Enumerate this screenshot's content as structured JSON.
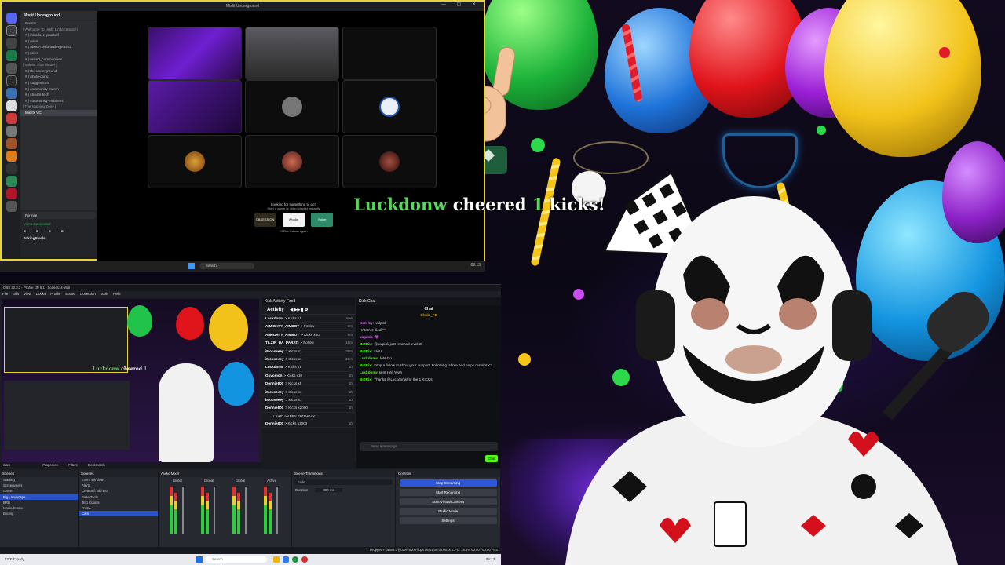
{
  "discord": {
    "window_title": "Misfit Underground",
    "server_name": "Misfit Underground",
    "channels": [
      {
        "label": "Events",
        "type": "item"
      },
      {
        "label": "| Welcome To Misfit Underground |",
        "type": "cat"
      },
      {
        "label": "# | introduce-yourself",
        "type": "item"
      },
      {
        "label": "# | rules",
        "type": "item"
      },
      {
        "label": "# | about-misfit-underground",
        "type": "item"
      },
      {
        "label": "# | roles",
        "type": "item"
      },
      {
        "label": "# | united_communities",
        "type": "item"
      },
      {
        "label": "| Videos That Matter |",
        "type": "cat"
      },
      {
        "label": "# | the-underground",
        "type": "item"
      },
      {
        "label": "# | photo-dump",
        "type": "item"
      },
      {
        "label": "# | suggestions",
        "type": "item"
      },
      {
        "label": "# | community-merch",
        "type": "item"
      },
      {
        "label": "# | stream-tech",
        "type": "item"
      },
      {
        "label": "# | community-emblems",
        "type": "item"
      },
      {
        "label": "| The Vapping Zone |",
        "type": "cat"
      },
      {
        "label": "Misfits VC",
        "type": "sel"
      }
    ],
    "activity_game": "Fortnite",
    "voice_status": "Video Connected",
    "username": "JokingPixels",
    "activity_prompt": "Looking for something to do?",
    "activity_sub": "Start a game or video playlist instantly",
    "activity_games": [
      "OBSESSION",
      "Wordle",
      "Poker"
    ],
    "dont_show": "Don't show again"
  },
  "taskbar_top": {
    "search_placeholder": "Search",
    "time": "09:13"
  },
  "alert": {
    "username": "Luckdonw",
    "verb": "cheered",
    "amount": "1",
    "unit": "kicks!"
  },
  "obs": {
    "title": "OBS 32.0.2 - Profile: JP 6.1 - Scenes: 4-Wall",
    "menu": [
      "File",
      "Edit",
      "View",
      "Docks",
      "Profile",
      "Scene Collection",
      "Tools",
      "Help"
    ],
    "scene_bar": "Cam",
    "scene_bar_tabs": [
      "Properties",
      "Filters",
      "Deskmerch"
    ],
    "scenes_header": "Scenes",
    "scenes": [
      "Starting",
      "Screenviews",
      "Game",
      "Big Landscape",
      "BRB",
      "Movie Scene",
      "Ending"
    ],
    "sources_header": "Sources",
    "sources": [
      "Event Window",
      "Alerts",
      "Creator.fl fold BG",
      "Base Tools",
      "Text Counts",
      "Game",
      "Cam"
    ],
    "mixer_header": "Audio Mixer",
    "mixer_channels": [
      "Global",
      "Global",
      "Global",
      "Active"
    ],
    "transitions_header": "Scene Transitions",
    "transition_value": "Fade",
    "duration_label": "Duration",
    "duration_value": "300 ms",
    "controls_header": "Controls",
    "controls": [
      "Stop Streaming",
      "Start Recording",
      "Start Virtual Camera",
      "Studio Mode",
      "Settings"
    ],
    "status": "Dropped Frames 0 (0.0%)   8000 kbps   04:41:06   00:00:00   CPU: 18.3%   60.00 / 60.00 FPS"
  },
  "feed": {
    "dock_title": "Kick Activity Feed",
    "toolbar_label": "Activity",
    "rows": [
      {
        "user": "Luckdonw",
        "action": "> Kicks x1",
        "time": "now"
      },
      {
        "user": "AIMIGHTY_AIMBOT",
        "action": "> Follow",
        "time": "8m"
      },
      {
        "user": "AIMIGHTY_AIMBOT",
        "action": "> Kicks x50",
        "time": "8m"
      },
      {
        "user": "TILZIN_DA_PARATI",
        "action": "> Follow",
        "time": "15m"
      },
      {
        "user": "iMouseeey",
        "action": "> Kicks x1",
        "time": "26m"
      },
      {
        "user": "iMouseeey",
        "action": "> Kicks x1",
        "time": "26m"
      },
      {
        "user": "Luckdonw",
        "action": "> Kicks x1",
        "time": "1h"
      },
      {
        "user": "Guyomon",
        "action": "> Kicks x10",
        "time": "1h"
      },
      {
        "user": "Donnie800",
        "action": "> Kicks x5",
        "time": "1h"
      },
      {
        "user": "iMouseeey",
        "action": "> Kicks x1",
        "time": "1h"
      },
      {
        "user": "iMouseeey",
        "action": "> Kicks x1",
        "time": "1h"
      },
      {
        "user": "Donnie800",
        "action": "> Kicks x2000",
        "time": "1h"
      }
    ],
    "sub_message": "I SAID HAPPY BIRTHDAY",
    "last_row": {
      "user": "Donnie800",
      "action": "> Kicks x1000",
      "time": "1h"
    }
  },
  "kick_chat": {
    "dock_title": "Kick Chat",
    "chat_title": "Chat",
    "pinned_user": "Chuila_PE",
    "messages": [
      {
        "user": "Sent by:",
        "text": "valpink",
        "color": "#d86cf0"
      },
      {
        "user": "",
        "text": "Internet died ^^",
        "color": "#ddd"
      },
      {
        "user": "valpinic",
        "text": "💜",
        "color": "#d86cf0"
      },
      {
        "user": "BotRix:",
        "text": "@valpink just reached level 2!",
        "color": "#53fc18"
      },
      {
        "user": "BotRix:",
        "text": "UwU",
        "color": "#53fc18"
      },
      {
        "user": "Luckdonw:",
        "text": "lets Go",
        "color": "#53fc18"
      },
      {
        "user": "BotRix:",
        "text": "Drop a follow to show your support! Following is free and helps out alot <3",
        "color": "#53fc18"
      },
      {
        "user": "Luckdonw",
        "text": "sent Hell Yeah",
        "color": "#53fc18"
      },
      {
        "user": "BotRix:",
        "text": "Thanks @Luckdonw for the 1 KICKs!",
        "color": "#53fc18"
      }
    ],
    "input_placeholder": "Send a message",
    "send_label": "Chat"
  },
  "taskbar_bottom": {
    "weather": "72°F Cloudy",
    "search_placeholder": "Search",
    "time": "09:13"
  },
  "colors": {
    "kick_green": "#53fc18",
    "alert_user": "#58d85a",
    "discord_border": "#e8d23a"
  }
}
